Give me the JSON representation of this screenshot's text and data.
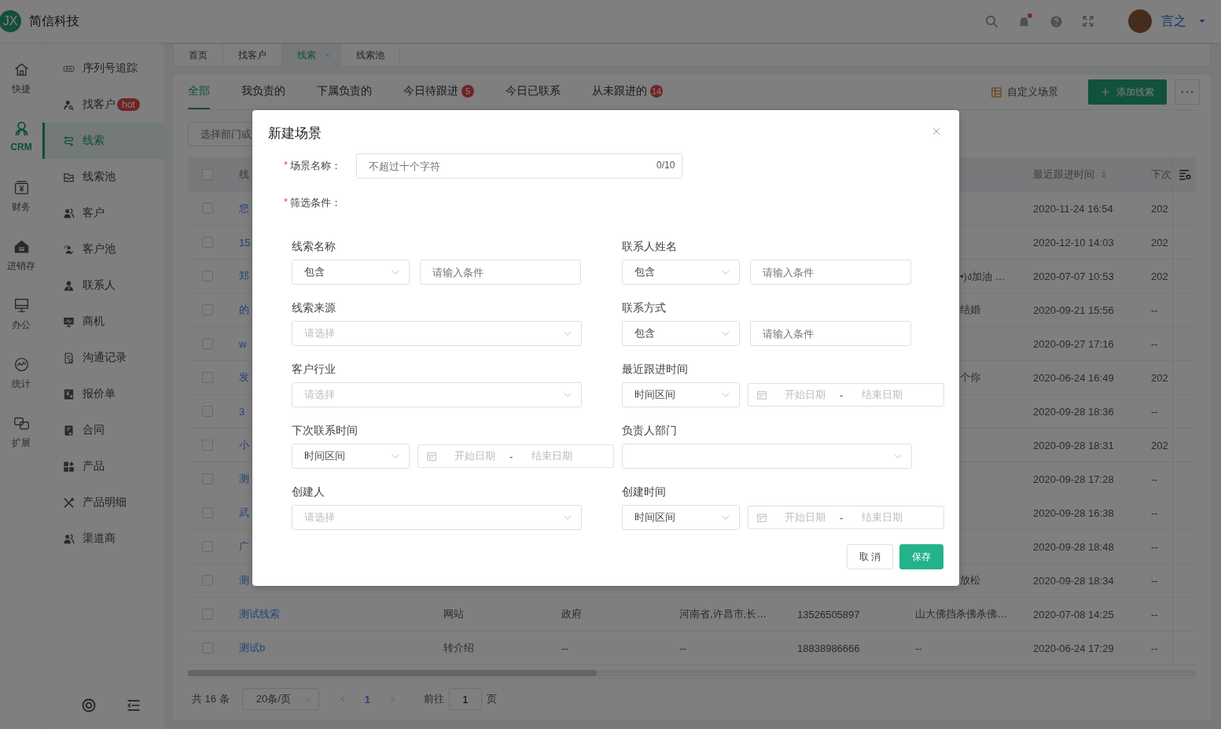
{
  "header": {
    "logo": "JX",
    "brand": "简信科技",
    "notification_dot": true,
    "user": "言之"
  },
  "rail": [
    {
      "label": "快捷",
      "selected": false
    },
    {
      "label": "CRM",
      "selected": true
    },
    {
      "label": "财务",
      "selected": false
    },
    {
      "label": "进销存",
      "selected": false
    },
    {
      "label": "办公",
      "selected": false
    },
    {
      "label": "统计",
      "selected": false
    },
    {
      "label": "扩展",
      "selected": false
    }
  ],
  "menu": [
    {
      "label": "序列号追踪",
      "selected": false
    },
    {
      "label": "找客户",
      "badge": "hot",
      "selected": false
    },
    {
      "label": "线索",
      "selected": true
    },
    {
      "label": "线索池",
      "selected": false
    },
    {
      "label": "客户",
      "selected": false
    },
    {
      "label": "客户池",
      "selected": false
    },
    {
      "label": "联系人",
      "selected": false
    },
    {
      "label": "商机",
      "selected": false
    },
    {
      "label": "沟通记录",
      "selected": false
    },
    {
      "label": "报价单",
      "selected": false
    },
    {
      "label": "合同",
      "selected": false
    },
    {
      "label": "产品",
      "selected": false
    },
    {
      "label": "产品明细",
      "selected": false
    },
    {
      "label": "渠道商",
      "selected": false
    }
  ],
  "page_tabs": [
    {
      "label": "首页",
      "selected": false,
      "closable": false
    },
    {
      "label": "找客户",
      "selected": false,
      "closable": false
    },
    {
      "label": "线索",
      "selected": true,
      "closable": true
    },
    {
      "label": "线索池",
      "selected": false,
      "closable": false
    }
  ],
  "scene_tabs": [
    {
      "label": "全部",
      "selected": true
    },
    {
      "label": "我负责的",
      "selected": false
    },
    {
      "label": "下属负责的",
      "selected": false
    },
    {
      "label": "今日待跟进",
      "count": "5",
      "selected": false
    },
    {
      "label": "今日已联系",
      "selected": false
    },
    {
      "label": "从未跟进的",
      "count": "14",
      "selected": false
    }
  ],
  "toolbar": {
    "custom_scene": "自定义场景",
    "add_button": "添加线索"
  },
  "filter": {
    "placeholder": "选择部门或"
  },
  "table": {
    "header": {
      "checked": false,
      "name": "线",
      "last_followup": "最近跟进时间",
      "next_followup": "下次"
    },
    "rows": [
      {
        "checked": false,
        "name": "您",
        "last_followup": "2020-11-24 16:54",
        "next_followup": "202"
      },
      {
        "checked": false,
        "name": "15",
        "last_followup": "2020-12-10 14:03",
        "next_followup": "202"
      },
      {
        "checked": false,
        "name": "郑",
        "note_tail": "•)ง加油 …",
        "last_followup": "2020-07-07 10:53",
        "next_followup": "202"
      },
      {
        "checked": false,
        "name": "的",
        "note_tail": "结婚",
        "last_followup": "2020-09-21 15:56",
        "next_followup": "--"
      },
      {
        "checked": false,
        "name": "w",
        "last_followup": "2020-09-27 17:16",
        "next_followup": "--"
      },
      {
        "checked": false,
        "name": "发",
        "note_tail": "个你",
        "last_followup": "2020-06-24 16:49",
        "next_followup": "202"
      },
      {
        "checked": false,
        "name": "3",
        "last_followup": "2020-09-28 18:36",
        "next_followup": "--"
      },
      {
        "checked": false,
        "name": "小",
        "last_followup": "2020-09-28 18:31",
        "next_followup": "202"
      },
      {
        "checked": false,
        "name": "测",
        "last_followup": "2020-09-28 17:28",
        "next_followup": "--"
      },
      {
        "checked": false,
        "name": "武",
        "last_followup": "2020-09-28 16:38",
        "next_followup": "--"
      },
      {
        "checked": false,
        "name": "广",
        "last_followup": "2020-09-28 18:48",
        "next_followup": "--"
      },
      {
        "checked": false,
        "name": "测",
        "note_tail": "放松",
        "last_followup": "2020-09-28 18:34",
        "next_followup": "--"
      },
      {
        "checked": false,
        "name": "测试线索",
        "source": "网站",
        "industry": "政府",
        "region": "河南省,许昌市,长…",
        "phone": "13526505897",
        "note": "山大佛挡杀佛杀佛…",
        "last_followup": "2020-07-08 14:25",
        "next_followup": "--"
      },
      {
        "checked": false,
        "name": "测试b",
        "source": "转介绍",
        "industry": "--",
        "region": "--",
        "phone": "18838986666",
        "note": "--",
        "last_followup": "2020-06-24 17:29",
        "next_followup": "--"
      }
    ]
  },
  "pager": {
    "total": "共 16 条",
    "page_size": "20条/页",
    "pages": [
      {
        "label": "1",
        "selected": true
      }
    ],
    "goto_label": "前往",
    "goto_value": "1",
    "page_unit": "页"
  },
  "dialog": {
    "title": "新建场景",
    "name_field": {
      "label": "场景名称：",
      "required_mark": "*",
      "placeholder": "不超过十个字符",
      "counter": "0/10"
    },
    "conditions_label": {
      "label": "筛选条件：",
      "required_mark": "*"
    },
    "conditions": [
      {
        "label": "线索名称",
        "kind": "text",
        "operator": "包含",
        "placeholder": "请输入条件"
      },
      {
        "label": "联系人姓名",
        "kind": "text",
        "operator": "包含",
        "placeholder": "请输入条件"
      },
      {
        "label": "线索来源",
        "kind": "select",
        "placeholder": "请选择"
      },
      {
        "label": "联系方式",
        "kind": "text",
        "operator": "包含",
        "placeholder": "请输入条件"
      },
      {
        "label": "客户行业",
        "kind": "select",
        "placeholder": "请选择"
      },
      {
        "label": "最近跟进时间",
        "kind": "daterange",
        "operator": "时间区间",
        "start_placeholder": "开始日期",
        "separator": "-",
        "end_placeholder": "结束日期"
      },
      {
        "label": "下次联系时间",
        "kind": "daterange",
        "operator": "时间区间",
        "start_placeholder": "开始日期",
        "separator": "-",
        "end_placeholder": "结束日期"
      },
      {
        "label": "负责人部门",
        "kind": "select"
      },
      {
        "label": "创建人",
        "kind": "select",
        "placeholder": "请选择"
      },
      {
        "label": "创建时间",
        "kind": "daterange",
        "operator": "时间区间",
        "start_placeholder": "开始日期",
        "separator": "-",
        "end_placeholder": "结束日期"
      }
    ],
    "buttons": [
      {
        "label": "取 消",
        "kind": "default"
      },
      {
        "label": "保存",
        "kind": "primary"
      }
    ]
  }
}
